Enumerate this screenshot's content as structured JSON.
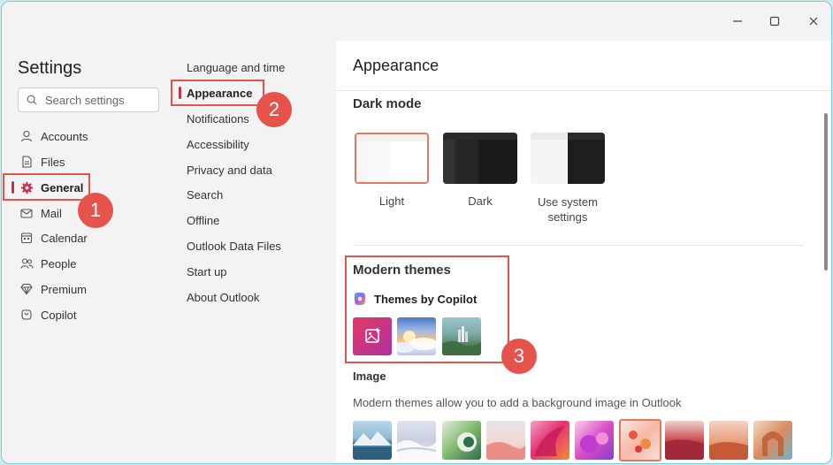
{
  "titlebar": {
    "minimize_icon": "minimize-icon",
    "maximize_icon": "maximize-icon",
    "close_icon": "close-icon"
  },
  "sidebar": {
    "title": "Settings",
    "search_placeholder": "Search settings",
    "items": [
      {
        "label": "Accounts",
        "icon": "person-icon"
      },
      {
        "label": "Files",
        "icon": "file-icon"
      },
      {
        "label": "General",
        "icon": "gear-icon",
        "active": true
      },
      {
        "label": "Mail",
        "icon": "mail-icon"
      },
      {
        "label": "Calendar",
        "icon": "calendar-icon"
      },
      {
        "label": "People",
        "icon": "people-icon"
      },
      {
        "label": "Premium",
        "icon": "diamond-icon"
      },
      {
        "label": "Copilot",
        "icon": "copilot-icon"
      }
    ]
  },
  "general_menu": {
    "items": [
      {
        "label": "Language and time"
      },
      {
        "label": "Appearance",
        "active": true
      },
      {
        "label": "Notifications"
      },
      {
        "label": "Accessibility"
      },
      {
        "label": "Privacy and data"
      },
      {
        "label": "Search"
      },
      {
        "label": "Offline"
      },
      {
        "label": "Outlook Data Files"
      },
      {
        "label": "Start up"
      },
      {
        "label": "About Outlook"
      }
    ]
  },
  "main": {
    "title": "Appearance",
    "dark_mode": {
      "title": "Dark mode",
      "options": [
        {
          "label": "Light",
          "selected": true
        },
        {
          "label": "Dark"
        },
        {
          "label": "Use system settings"
        }
      ]
    },
    "modern_themes": {
      "title": "Modern themes",
      "copilot_label": "Themes by Copilot"
    },
    "image": {
      "title": "Image",
      "description": "Modern themes allow you to add a background image in Outlook"
    }
  },
  "annotations": {
    "badges": [
      "1",
      "2",
      "3"
    ],
    "color": "#e5534b"
  },
  "colors": {
    "accent": "#c4314b",
    "selected_border": "#e07a5f",
    "window_border": "#7ecad6"
  }
}
